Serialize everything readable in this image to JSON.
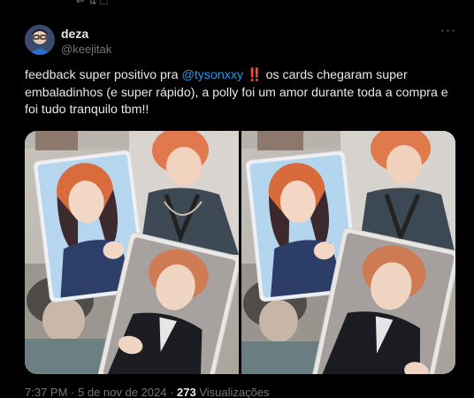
{
  "tweet": {
    "author": {
      "display_name": "deza",
      "handle": "@keejitak"
    },
    "text_before": "feedback super positivo pra ",
    "mention": "@tysonxxy",
    "text_after": " ‼️ os cards chegaram super embaladinhos (e super rápido), a polly foi um amor durante toda a compra e foi tudo tranquilo tbm!!",
    "time": "7:37 PM",
    "separator": " · ",
    "date": "5 de nov de 2024",
    "views_count": "273",
    "views_label": " Visualizações"
  },
  "icons": {
    "more": "more-horizontal-icon"
  }
}
